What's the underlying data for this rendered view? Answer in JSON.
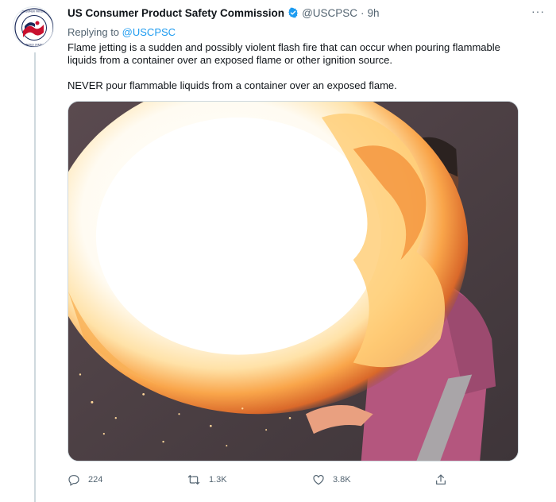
{
  "tweet": {
    "author_name": "US Consumer Product Safety Commission",
    "handle": "@USCPSC",
    "separator": "·",
    "time": "9h",
    "more_label": "···",
    "replying_prefix": "Replying to",
    "replying_to": "@USCPSC",
    "paragraph_1": "Flame jetting is a sudden and possibly violent flash fire that can occur when pouring flammable liquids from a container over an exposed flame or other ignition source.",
    "paragraph_2": "NEVER pour flammable liquids from a container over an exposed flame.",
    "avatar_ring_text": "CONSUMER PRODUCT SAFETY COMMISSION · UNITED STATES"
  },
  "actions": {
    "reply_count": "224",
    "retweet_count": "1.3K",
    "like_count": "3.8K"
  },
  "icons": {
    "verified": "verified-badge-icon",
    "more": "more-icon",
    "reply": "reply-icon",
    "retweet": "retweet-icon",
    "like": "heart-icon",
    "share": "share-icon"
  },
  "colors": {
    "accent": "#1d9bf0",
    "secondary_text": "#536471",
    "primary_text": "#0f1419"
  }
}
